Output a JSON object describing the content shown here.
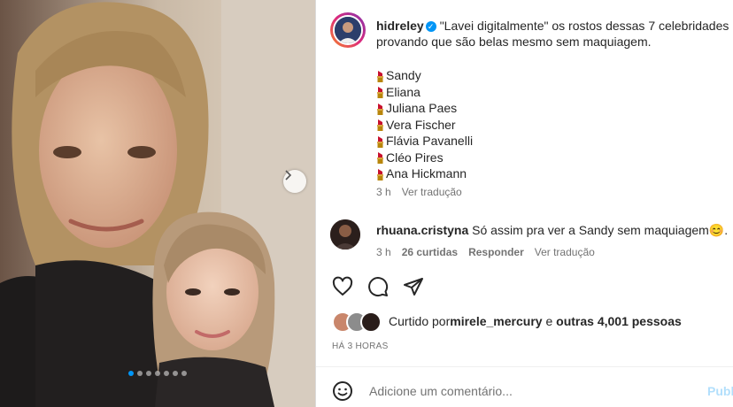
{
  "post": {
    "username": "hidreley",
    "caption": "\"Lavei digitalmente\" os rostos dessas 7 celebridades provando que são belas mesmo sem maquiagem.",
    "list": [
      "Sandy",
      "Eliana",
      "Juliana Paes",
      "Vera Fischer",
      "Flávia Pavanelli",
      "Cléo Pires",
      "Ana Hickmann"
    ],
    "time": "3 h",
    "translate": "Ver tradução"
  },
  "comment": {
    "username": "rhuana.cristyna",
    "text": "Só assim pra ver a Sandy sem maquiagem",
    "emoji": "😊",
    "time": "3 h",
    "likes": "26 curtidas",
    "reply": "Responder",
    "translate": "Ver tradução"
  },
  "likes": {
    "prefix": "Curtido por ",
    "user": "mirele_mercury",
    "middle": " e ",
    "others": "outras 4,001 pessoas"
  },
  "time_ago": "HÁ 3 HORAS",
  "comment_input": {
    "placeholder": "Adicione um comentário...",
    "publish": "Publi"
  },
  "carousel": {
    "count": 7,
    "active": 0
  },
  "colors": {
    "accent": "#0095f6",
    "text": "#262626",
    "muted": "#737373",
    "lipstick": "#c8102e"
  }
}
